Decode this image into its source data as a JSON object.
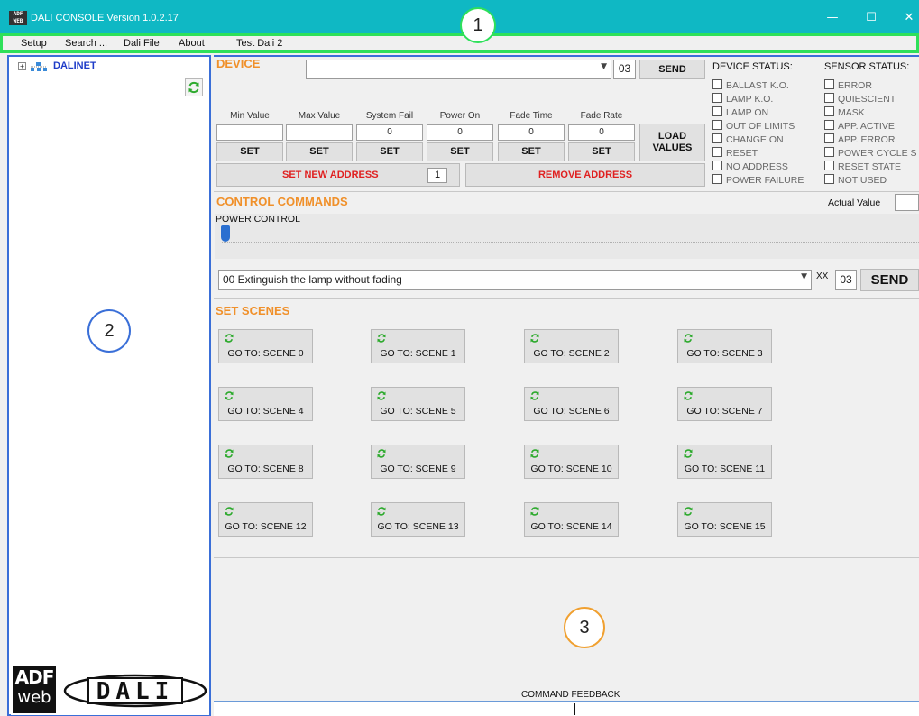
{
  "window": {
    "title": "DALI CONSOLE Version 1.0.2.17",
    "logo_text": "ADF WEB",
    "minimize": "—",
    "maximize": "☐",
    "close": "✕",
    "title_bar_color": "#0fb8c4"
  },
  "menu": {
    "items": [
      "Setup",
      "Search ...",
      "Dali File",
      "About",
      "Test Dali 2"
    ]
  },
  "annotations": [
    "1",
    "2",
    "3"
  ],
  "tree": {
    "root_label": "DALINET",
    "expander": "+"
  },
  "logos": {
    "adf_top": "ADF",
    "adf_bottom": "web",
    "dali": "DALI"
  },
  "device": {
    "title": "DEVICE",
    "selected": "",
    "address": "03",
    "send_label": "SEND",
    "params": [
      {
        "label": "Min Value",
        "value": ""
      },
      {
        "label": "Max Value",
        "value": ""
      },
      {
        "label": "System Fail",
        "value": "0"
      },
      {
        "label": "Power On",
        "value": "0"
      },
      {
        "label": "Fade Time",
        "value": "0"
      },
      {
        "label": "Fade Rate",
        "value": "0"
      }
    ],
    "set_label": "SET",
    "load_values_line1": "LOAD",
    "load_values_line2": "VALUES",
    "set_new_address_label": "SET NEW ADDRESS",
    "new_address_value": "1",
    "remove_address_label": "REMOVE  ADDRESS"
  },
  "device_status": {
    "title": "DEVICE STATUS:",
    "items": [
      "BALLAST K.O.",
      "LAMP K.O.",
      "LAMP ON",
      "OUT OF LIMITS",
      "CHANGE ON",
      "RESET",
      "NO ADDRESS",
      "POWER FAILURE"
    ]
  },
  "sensor_status": {
    "title": "SENSOR STATUS:",
    "items": [
      "ERROR",
      "QUIESCIENT",
      "MASK",
      "APP. ACTIVE",
      "APP. ERROR",
      "POWER CYCLE S",
      "RESET STATE",
      "NOT USED"
    ]
  },
  "control": {
    "title": "CONTROL COMMANDS",
    "actual_value_label": "Actual Value",
    "actual_value": "",
    "power_control_label": "POWER CONTROL",
    "power_level": 0,
    "command_selected": "00 Extinguish the lamp without fading",
    "xx_label": "XX",
    "address": "03",
    "send_label": "SEND"
  },
  "scenes": {
    "title": "SET SCENES",
    "items": [
      "GO TO: SCENE 0",
      "GO TO: SCENE 1",
      "GO TO: SCENE 2",
      "GO TO: SCENE 3",
      "GO TO: SCENE 4",
      "GO TO: SCENE 5",
      "GO TO: SCENE 6",
      "GO TO: SCENE 7",
      "GO TO: SCENE 8",
      "GO TO: SCENE 9",
      "GO TO: SCENE 10",
      "GO TO: SCENE 11",
      "GO TO: SCENE 12",
      "GO TO: SCENE 13",
      "GO TO: SCENE 14",
      "GO TO: SCENE 15"
    ]
  },
  "feedback": {
    "label": "COMMAND FEEDBACK",
    "value": ""
  }
}
